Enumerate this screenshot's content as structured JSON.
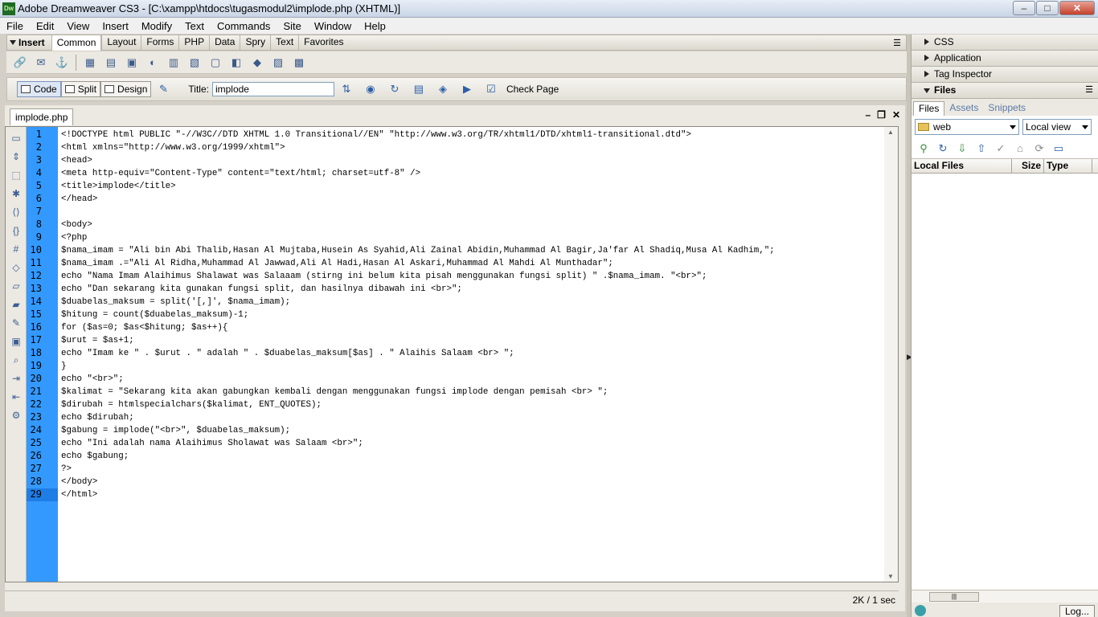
{
  "window": {
    "title": "Adobe Dreamweaver CS3 - [C:\\xampp\\htdocs\\tugasmodul2\\implode.php (XHTML)]",
    "app_icon": "Dw",
    "minimize": "–",
    "maximize": "□",
    "close": "✕"
  },
  "menu": [
    "File",
    "Edit",
    "View",
    "Insert",
    "Modify",
    "Text",
    "Commands",
    "Site",
    "Window",
    "Help"
  ],
  "insert_bar": {
    "label": "Insert",
    "tabs": [
      "Common",
      "Layout",
      "Forms",
      "PHP",
      "Data",
      "Spry",
      "Text",
      "Favorites"
    ],
    "active_tab": "Common"
  },
  "doc_toolbar": {
    "code_label": "Code",
    "split_label": "Split",
    "design_label": "Design",
    "title_label": "Title:",
    "title_value": "implode",
    "check_page_label": "Check Page"
  },
  "document": {
    "tab": "implode.php",
    "minimize": "–",
    "restore": "❐",
    "close": "✕",
    "status": "2K / 1 sec",
    "lines": [
      "<!DOCTYPE html PUBLIC \"-//W3C//DTD XHTML 1.0 Transitional//EN\" \"http://www.w3.org/TR/xhtml1/DTD/xhtml1-transitional.dtd\">",
      "<html xmlns=\"http://www.w3.org/1999/xhtml\">",
      "<head>",
      "<meta http-equiv=\"Content-Type\" content=\"text/html; charset=utf-8\" />",
      "<title>implode</title>",
      "</head>",
      "",
      "<body>",
      "<?php",
      "$nama_imam = \"Ali bin Abi Thalib,Hasan Al Mujtaba,Husein As Syahid,Ali Zainal Abidin,Muhammad Al Bagir,Ja'far Al Shadiq,Musa Al Kadhim,\";",
      "$nama_imam .=\"Ali Al Ridha,Muhammad Al Jawwad,Ali Al Hadi,Hasan Al Askari,Muhammad Al Mahdi Al Munthadar\";",
      "echo \"Nama Imam Alaihimus Shalawat was Salaaam (stirng ini belum kita pisah menggunakan fungsi split) \" .$nama_imam. \"<br>\";",
      "echo \"Dan sekarang kita gunakan fungsi split, dan hasilnya dibawah ini <br>\";",
      "$duabelas_maksum = split('[,]', $nama_imam);",
      "$hitung = count($duabelas_maksum)-1;",
      "for ($as=0; $as<$hitung; $as++){",
      "$urut = $as+1;",
      "echo \"Imam ke \" . $urut . \" adalah \" . $duabelas_maksum[$as] . \" Alaihis Salaam <br> \";",
      "}",
      "echo \"<br>\";",
      "$kalimat = \"Sekarang kita akan gabungkan kembali dengan menggunakan fungsi implode dengan pemisah <br> \";",
      "$dirubah = htmlspecialchars($kalimat, ENT_QUOTES);",
      "echo $dirubah;",
      "$gabung = implode(\"<br>\", $duabelas_maksum);",
      "echo \"Ini adalah nama Alaihimus Sholawat was Salaam <br>\";",
      "echo $gabung;",
      "?>",
      "</body>",
      "</html>"
    ],
    "line_numbers": [
      "1",
      "2",
      "3",
      "4",
      "5",
      "6",
      "7",
      "8",
      "9",
      "10",
      "11",
      "12",
      "13",
      "14",
      "15",
      "16",
      "17",
      "18",
      "19",
      "20",
      "21",
      "22",
      "23",
      "24",
      "25",
      "26",
      "27",
      "28",
      "29"
    ],
    "current_line": 29
  },
  "panels": {
    "css": "CSS",
    "application": "Application",
    "tag_inspector": "Tag Inspector",
    "files": "Files",
    "file_tabs": [
      "Files",
      "Assets",
      "Snippets"
    ],
    "site_select": "web",
    "view_select": "Local view",
    "columns": [
      "Local Files",
      "Size",
      "Type"
    ],
    "log_button": "Log..."
  }
}
